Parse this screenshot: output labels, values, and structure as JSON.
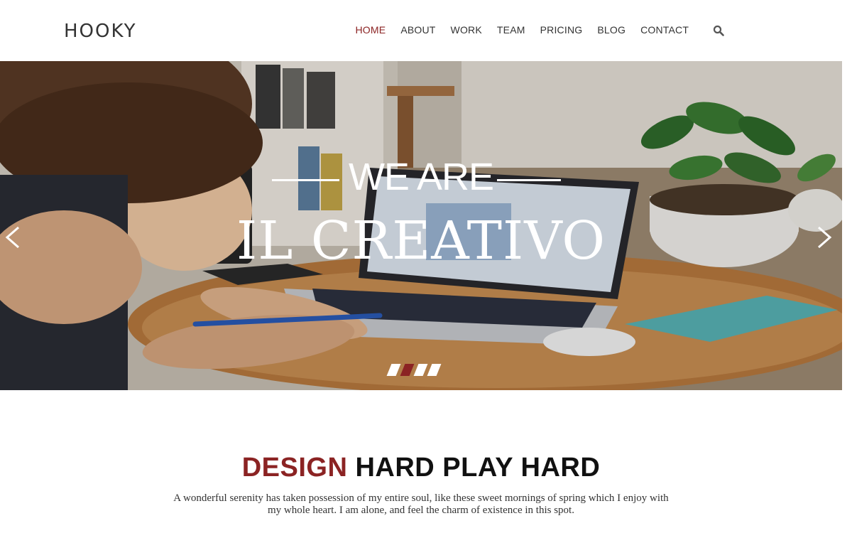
{
  "header": {
    "logo": "HOOKY",
    "nav": [
      "HOME",
      "ABOUT",
      "WORK",
      "TEAM",
      "PRICING",
      "BLOG",
      "CONTACT"
    ],
    "active_nav": "HOME",
    "search_icon": "search-icon"
  },
  "hero": {
    "line1": "WE ARE",
    "line2": "IL CREATIVO",
    "slides": 4,
    "active_slide": 2,
    "prev_icon": "chevron-left-icon",
    "next_icon": "chevron-right-icon"
  },
  "intro": {
    "heading_accent": "DESIGN",
    "heading_rest": "HARD PLAY HARD",
    "text": "A wonderful serenity has taken possession of my entire soul, like these sweet mornings of spring which I enjoy with my whole heart. I am alone, and feel the charm of existence in this spot."
  },
  "colors": {
    "accent": "#8b2323",
    "text": "#333333",
    "background": "#ffffff"
  }
}
